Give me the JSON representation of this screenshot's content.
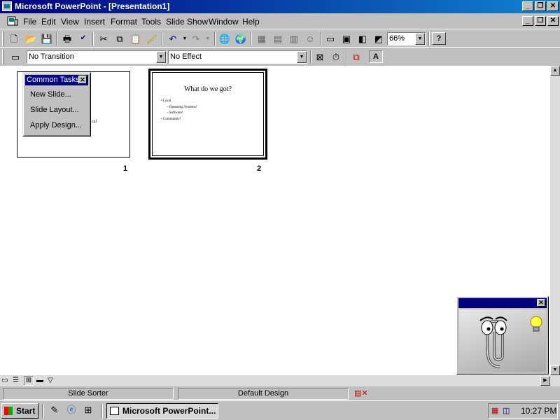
{
  "window": {
    "title": "Microsoft PowerPoint - [Presentation1]"
  },
  "menu": {
    "items": [
      "File",
      "Edit",
      "View",
      "Insert",
      "Format",
      "Tools",
      "Slide Show",
      "Window",
      "Help"
    ]
  },
  "toolbar": {
    "zoom": "66%"
  },
  "sorter_toolbar": {
    "transition": "No Transition",
    "effect": "No Effect"
  },
  "common_tasks": {
    "title": "Common Tasks",
    "items": [
      "New Slide...",
      "Slide Layout...",
      "Apply Design..."
    ]
  },
  "slides": [
    {
      "number": "1",
      "partial_text": "cal"
    },
    {
      "number": "2",
      "title": "What do we got?",
      "bullets": [
        "Local",
        "– Operating Systems!",
        "– Software!",
        "Community!"
      ]
    }
  ],
  "status": {
    "view": "Slide Sorter",
    "design": "Default Design"
  },
  "taskbar": {
    "start": "Start",
    "app": "Microsoft PowerPoint...",
    "time": "10:27 PM"
  },
  "colors": {
    "titlebar": "#000080",
    "face": "#c0c0c0"
  }
}
